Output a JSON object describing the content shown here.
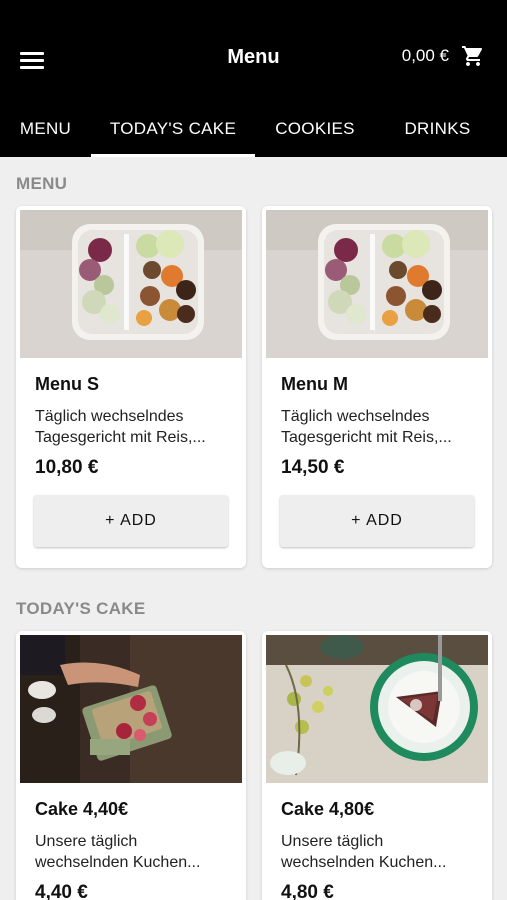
{
  "appbar": {
    "title": "Menu",
    "cart_total": "0,00 €",
    "menu_icon": "hamburger-menu-icon",
    "cart_icon": "shopping-cart-icon"
  },
  "tabs": [
    {
      "label": "MENU",
      "active": false
    },
    {
      "label": "TODAY'S CAKE",
      "active": true
    },
    {
      "label": "COOKIES",
      "active": false
    },
    {
      "label": "DRINKS",
      "active": false
    }
  ],
  "sections": [
    {
      "title": "MENU",
      "items": [
        {
          "name": "Menu S",
          "desc_line1": "Täglich wechselndes",
          "desc_line2": "Tagesgericht mit Reis,...",
          "price": "10,80 €",
          "button": "+ ADD",
          "image": "salad-bowl-photo"
        },
        {
          "name": "Menu M",
          "desc_line1": "Täglich wechselndes",
          "desc_line2": "Tagesgericht mit Reis,...",
          "price": "14,50 €",
          "button": "+ ADD",
          "image": "salad-bowl-photo"
        }
      ]
    },
    {
      "title": "TODAY'S CAKE",
      "items": [
        {
          "name": "Cake 4,40€",
          "desc_line1": "Unsere täglich",
          "desc_line2": "wechselnden Kuchen...",
          "price": "4,40 €",
          "image": "cake-slice-in-hand-photo"
        },
        {
          "name": "Cake 4,80€",
          "desc_line1": "Unsere täglich",
          "desc_line2": "wechselnden Kuchen...",
          "price": "4,80 €",
          "image": "cake-on-plate-photo"
        }
      ]
    }
  ],
  "colors": {
    "appbar_bg": "#000000",
    "page_bg": "#efefef",
    "section_title": "#8a8a8a",
    "card_bg": "#ffffff"
  }
}
